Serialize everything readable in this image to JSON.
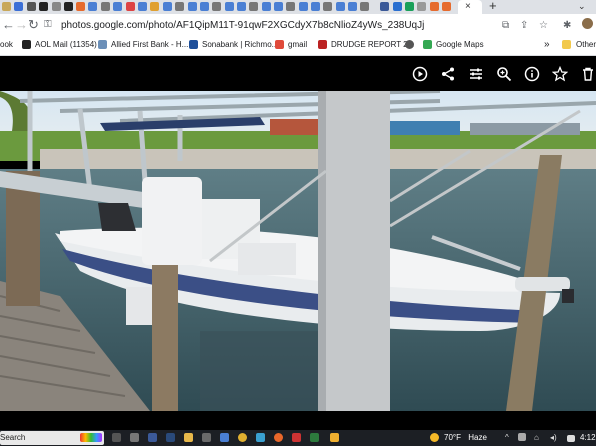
{
  "browser": {
    "address_bar": {
      "url": "photos.google.com/photo/AF1QipM11T-91qwF2XGCdyX7b8cNlioZ4yWs_238UqJj"
    },
    "bookmarks": {
      "items": [
        {
          "label": "ook"
        },
        {
          "label": "AOL Mail (11354)"
        },
        {
          "label": "Allied First Bank - H..."
        },
        {
          "label": "Sonabank | Richmo..."
        },
        {
          "label": "gmail"
        },
        {
          "label": "DRUDGE REPORT 2..."
        },
        {
          "label": "Google Maps"
        }
      ],
      "more": "»",
      "other": "Other"
    },
    "tab": {
      "close": "×",
      "new": "+",
      "menu": "⌄"
    },
    "nav": {
      "back": "←",
      "forward": "→",
      "reload": "↻",
      "lock": "⚿"
    },
    "toolbar_icons": {
      "open": "⧉",
      "share": "⇪",
      "star": "☆",
      "extensions": "✱",
      "sidebar": "◫"
    }
  },
  "viewer": {
    "icons": [
      "play-icon",
      "share-icon",
      "tune-icon",
      "zoom-icon",
      "info-icon",
      "star-icon",
      "delete-icon"
    ]
  },
  "taskbar": {
    "search_label": "Search",
    "weather": {
      "temp": "70°F",
      "condition": "Haze"
    },
    "tray": {
      "chevron": "^",
      "network": "⌂",
      "volume": "◂)"
    },
    "clock": "4:12"
  }
}
